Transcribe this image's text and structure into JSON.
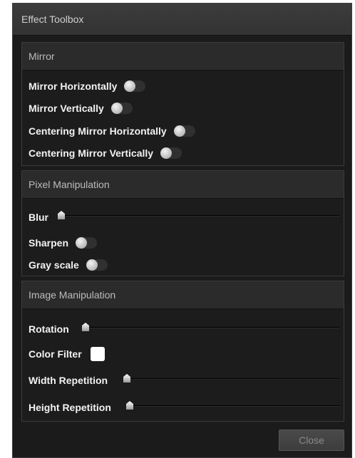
{
  "window": {
    "title": "Effect Toolbox"
  },
  "mirror": {
    "header": "Mirror",
    "items": [
      {
        "label": "Mirror Horizontally",
        "on": false
      },
      {
        "label": "Mirror Vertically",
        "on": false
      },
      {
        "label": "Centering Mirror Horizontally",
        "on": false
      },
      {
        "label": "Centering Mirror Vertically",
        "on": false
      }
    ]
  },
  "pixel": {
    "header": "Pixel Manipulation",
    "blur": {
      "label": "Blur",
      "value": 0
    },
    "sharpen": {
      "label": "Sharpen",
      "on": false
    },
    "grayscale": {
      "label": "Gray scale",
      "on": false
    }
  },
  "image": {
    "header": "Image Manipulation",
    "rotation": {
      "label": "Rotation",
      "value": 0
    },
    "color_filter": {
      "label": "Color Filter",
      "color": "#ffffff"
    },
    "width_repetition": {
      "label": "Width Repetition",
      "value": 0
    },
    "height_repetition": {
      "label": "Height Repetition",
      "value": 0
    }
  },
  "footer": {
    "close_label": "Close"
  }
}
